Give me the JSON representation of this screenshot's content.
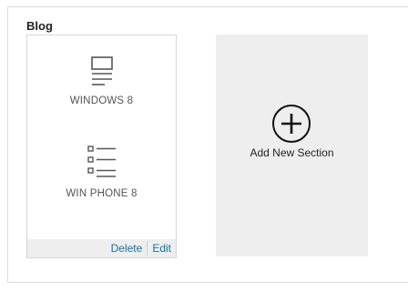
{
  "group": {
    "title": "Blog"
  },
  "section": {
    "items": [
      {
        "label": "WINDOWS 8",
        "icon": "page-icon"
      },
      {
        "label": "WIN PHONE 8",
        "icon": "list-icon"
      }
    ],
    "actions": {
      "delete_label": "Delete",
      "edit_label": "Edit"
    }
  },
  "add_section": {
    "label": "Add New Section",
    "icon": "plus-circle-icon"
  },
  "colors": {
    "link": "#1a6fa8",
    "card_background": "#eeeeee",
    "border": "#d6d6d6",
    "icon_stroke": "#555555"
  }
}
